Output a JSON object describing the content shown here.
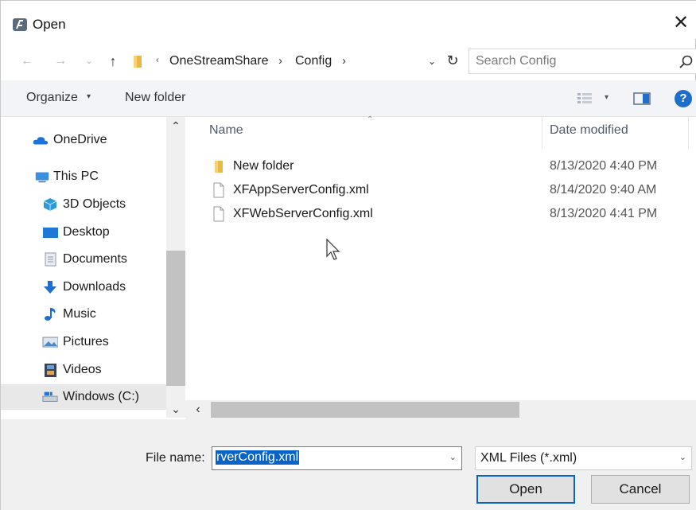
{
  "window": {
    "title": "Open",
    "close_glyph": "✕"
  },
  "address": {
    "crumbs": [
      "OneStreamShare",
      "Config"
    ],
    "search_placeholder": "Search Config"
  },
  "toolbar": {
    "organize_label": "Organize",
    "new_folder_label": "New folder",
    "help_glyph": "?"
  },
  "nav": {
    "items": [
      {
        "label": "OneDrive",
        "icon": "cloud-icon"
      },
      {
        "label": "This PC",
        "icon": "computer-icon"
      },
      {
        "label": "3D Objects",
        "icon": "cube-icon"
      },
      {
        "label": "Desktop",
        "icon": "desktop-icon"
      },
      {
        "label": "Documents",
        "icon": "document-icon"
      },
      {
        "label": "Downloads",
        "icon": "download-icon"
      },
      {
        "label": "Music",
        "icon": "music-note-icon"
      },
      {
        "label": "Pictures",
        "icon": "picture-icon"
      },
      {
        "label": "Videos",
        "icon": "film-icon"
      },
      {
        "label": "Windows (C:)",
        "icon": "drive-icon"
      }
    ],
    "selected": "Windows (C:)"
  },
  "filelist": {
    "columns": {
      "name": "Name",
      "date": "Date modified"
    },
    "rows": [
      {
        "name": "New folder",
        "date": "8/13/2020 4:40 PM",
        "type": "folder"
      },
      {
        "name": "XFAppServerConfig.xml",
        "date": "8/14/2020 9:40 AM",
        "type": "file"
      },
      {
        "name": "XFWebServerConfig.xml",
        "date": "8/13/2020 4:41 PM",
        "type": "file"
      }
    ]
  },
  "bottom": {
    "filename_label": "File name:",
    "filename_value": "rverConfig.xml",
    "filetype_value": "XML Files (*.xml)",
    "open_label": "Open",
    "cancel_label": "Cancel"
  },
  "colors": {
    "accent": "#0a64c8",
    "folder": "#e8b84a",
    "command_bar_bg": "#f2f4f8",
    "bottom_bg": "#f0f0f0"
  }
}
